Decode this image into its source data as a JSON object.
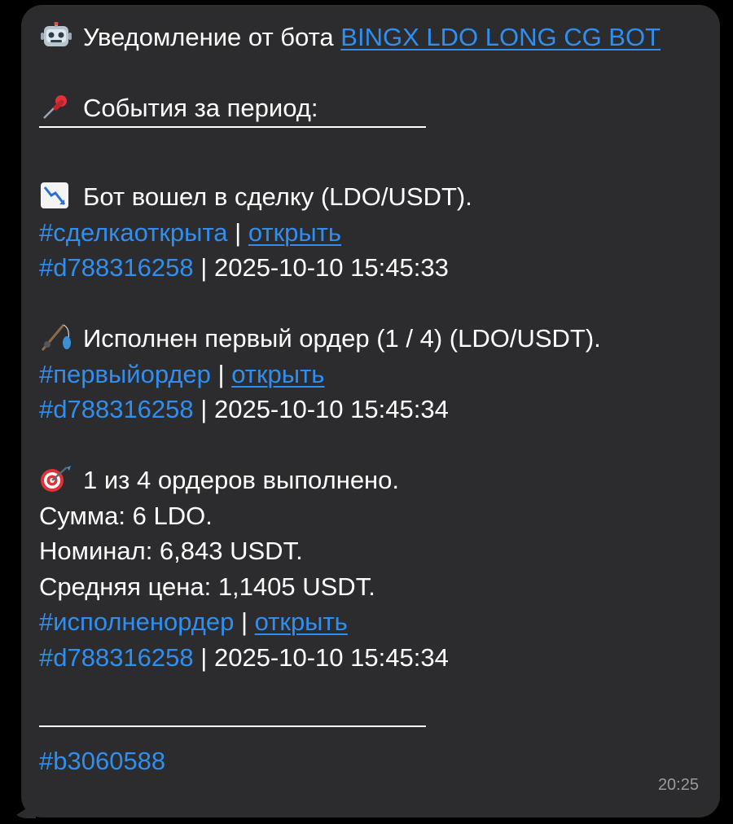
{
  "message": {
    "header_prefix": "Уведомление от бота",
    "bot_name": "BINGX LDO LONG CG BOT",
    "period_title": "События за период:",
    "events": [
      {
        "icon": "chart-decreasing-icon",
        "title": "Бот вошел в сделку (LDO/USDT).",
        "tag": "#сделкаоткрыта",
        "open_label": "открыть",
        "deal_tag": "#d788316258",
        "timestamp": "2025-10-10 15:45:33"
      },
      {
        "icon": "fishing-pole-icon",
        "title": "Исполнен первый ордер (1 / 4) (LDO/USDT).",
        "tag": "#первыйордер",
        "open_label": "открыть",
        "deal_tag": "#d788316258",
        "timestamp": "2025-10-10 15:45:34"
      },
      {
        "icon": "dart-target-icon",
        "title": "1 из 4 ордеров выполнено.",
        "sum": "Сумма: 6 LDO.",
        "nominal": "Номинал: 6,843 USDT.",
        "avg_price": "Средняя цена: 1,1405 USDT.",
        "tag": "#исполненордер",
        "open_label": "открыть",
        "deal_tag": "#d788316258",
        "timestamp": "2025-10-10 15:45:34"
      }
    ],
    "bot_tag": "#b3060588",
    "time": "20:25",
    "separator": "|"
  }
}
